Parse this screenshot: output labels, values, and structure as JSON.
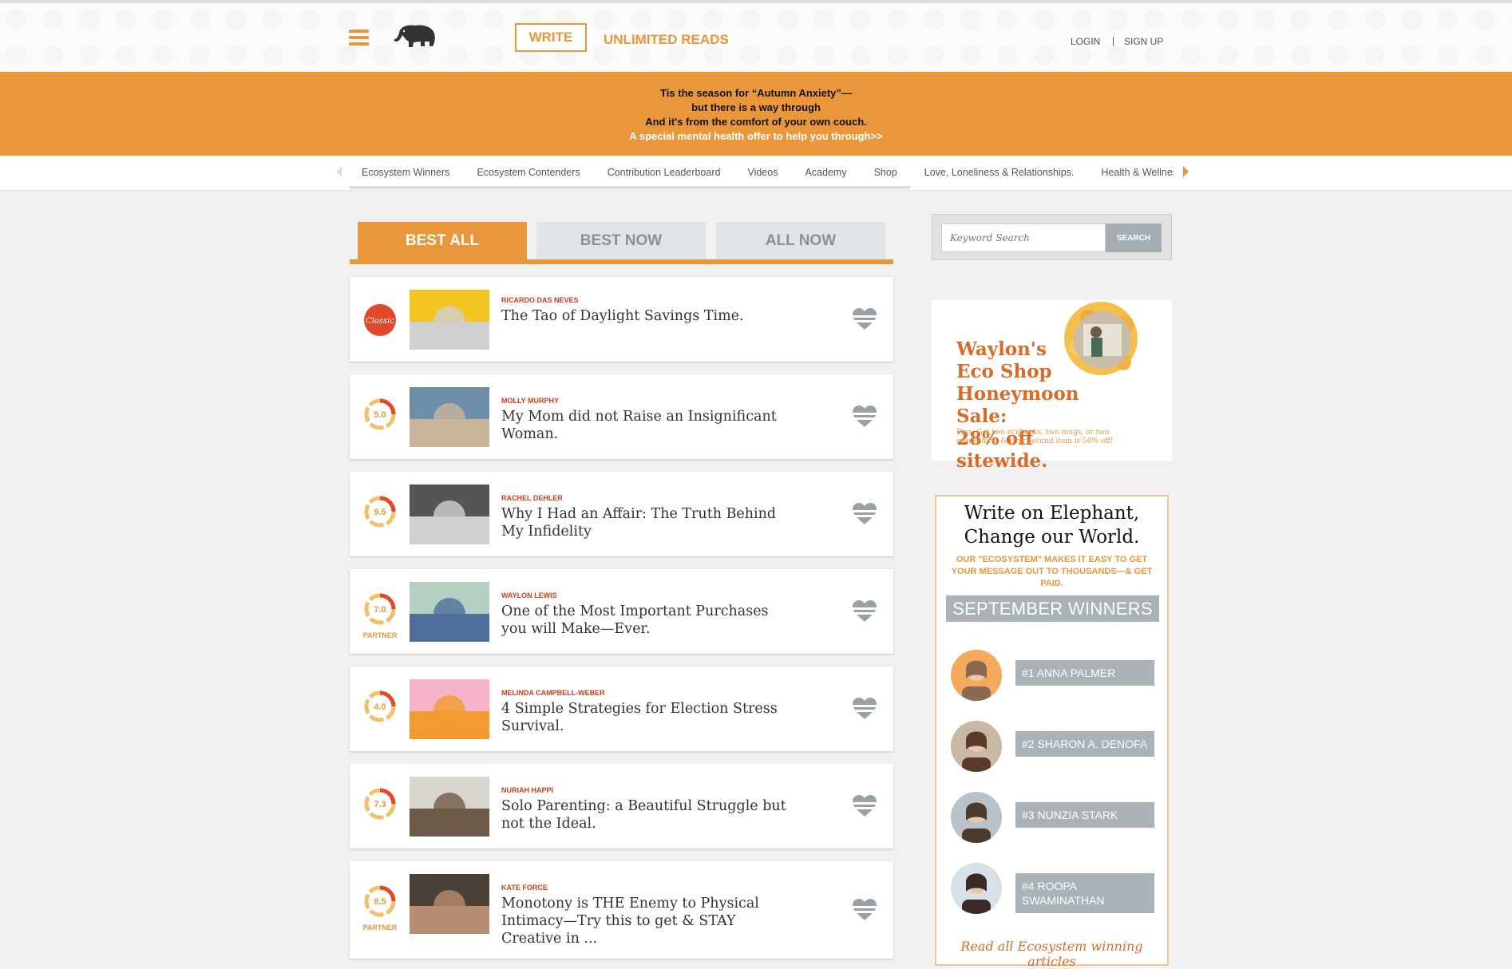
{
  "header": {
    "write_label": "WRITE",
    "unlimited_label": "UNLIMITED READS",
    "login_label": "LOGIN",
    "separator": "|",
    "signup_label": "SIGN UP"
  },
  "banner": {
    "line1": "Tis the season for “Autumn Anxiety”—",
    "line2": "but there is a way through",
    "line3": "And it's from the comfort of your own couch.",
    "line4": "A special mental health offer to help you through>>"
  },
  "categories": [
    "Ecosystem Winners",
    "Ecosystem Contenders",
    "Contribution Leaderboard",
    "Videos",
    "Academy",
    "Shop",
    "Love, Loneliness & Relationships.",
    "Health & Wellness"
  ],
  "tabs": [
    "BEST ALL",
    "BEST NOW",
    "ALL NOW"
  ],
  "articles": [
    {
      "author": "RICARDO DAS NEVES",
      "title": "The Tao of Daylight Savings Time.",
      "score": "Classic",
      "partner": "",
      "badge_type": "classic"
    },
    {
      "author": "MOLLY MURPHY",
      "title": "My Mom did not Raise an Insignificant Woman.",
      "score": "5.0",
      "partner": "",
      "badge_type": "score"
    },
    {
      "author": "RACHEL DEHLER",
      "title": "Why I Had an Affair: The Truth Behind My Infidelity",
      "score": "9.5",
      "partner": "",
      "badge_type": "score"
    },
    {
      "author": "WAYLON LEWIS",
      "title": "One of the Most Important Purchases you will Make—Ever.",
      "score": "7.0",
      "partner": "PARTNER",
      "badge_type": "score"
    },
    {
      "author": "MELINDA CAMPBELL-WEBER",
      "title": "4 Simple Strategies for Election Stress Survival.",
      "score": "4.0",
      "partner": "",
      "badge_type": "score"
    },
    {
      "author": "NURIAH HAPPI",
      "title": "Solo Parenting: a Beautiful Struggle but not the Ideal.",
      "score": "7.3",
      "partner": "",
      "badge_type": "score"
    },
    {
      "author": "KATE FORCE",
      "title": "Monotony is THE Enemy to Physical Intimacy—Try this to get & STAY Creative in ...",
      "score": "8.5",
      "partner": "PARTNER",
      "badge_type": "score"
    }
  ],
  "search": {
    "placeholder": "Keyword Search",
    "button_label": "SEARCH"
  },
  "ad": {
    "title_line1": "Waylon's",
    "title_line2": "Eco Shop",
    "title_line3": "Honeymoon Sale:",
    "title_line4": "28% off sitewide.",
    "small_text": "Plus: Get two ecobooks, two mugs, or two sweatshirts & your second item is 50% off!"
  },
  "winners": {
    "title": "Write on Elephant, Change our World.",
    "subtitle": "OUR \"ECOSYSTEM\" MAKES IT EASY TO GET YOUR MESSAGE OUT TO THOUSANDS—& GET PAID.",
    "heading": "SEPTEMBER WINNERS",
    "list": [
      "#1 ANNA PALMER",
      "#2 SHARON A. DENOFA",
      "#3 NUNZIA STARK",
      "#4 ROOPA SWAMINATHAN"
    ],
    "read_all": "Read all Ecosystem winning articles"
  },
  "colors": {
    "accent": "#ea973c",
    "author_red": "#c2421e",
    "tab_inactive": "#e1e4e7",
    "winner_gray": "#a9b2b7"
  }
}
